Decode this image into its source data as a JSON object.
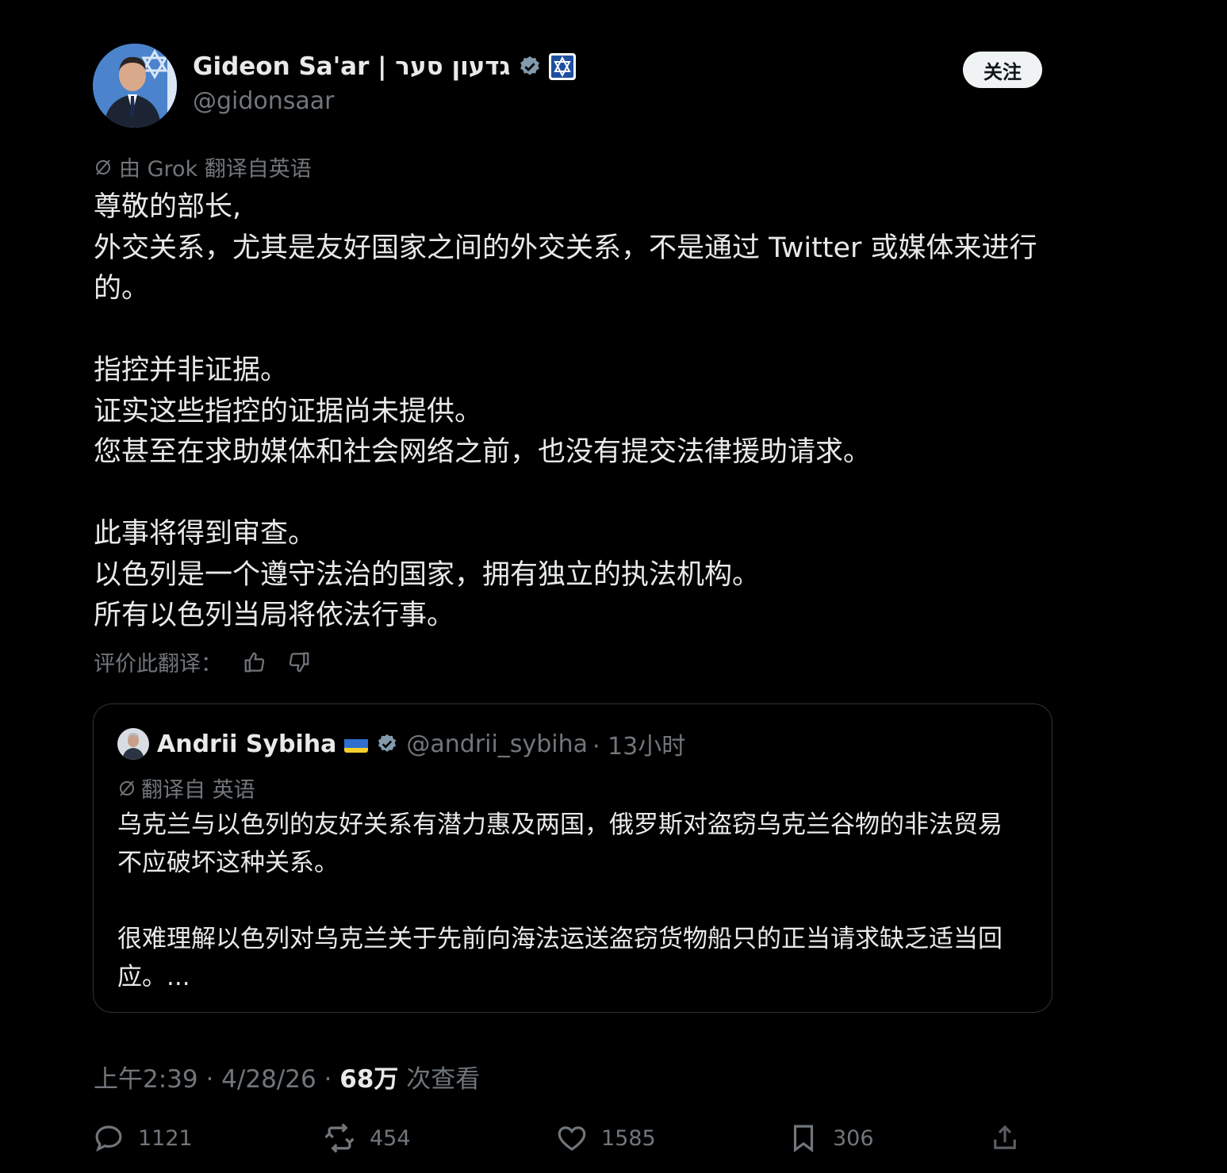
{
  "author": {
    "display_name": "Gideon Sa'ar | גדעון סער",
    "handle": "@gidonsaar",
    "follow_label": "关注"
  },
  "translation_note": "由 Grok 翻译自英语",
  "post": {
    "paragraphs": [
      [
        "尊敬的部长,",
        "外交关系，尤其是友好国家之间的外交关系，不是通过 Twitter 或媒体来进行的。"
      ],
      [
        "指控并非证据。",
        "证实这些指控的证据尚未提供。",
        "您甚至在求助媒体和社会网络之前，也没有提交法律援助请求。"
      ],
      [
        "此事将得到审查。",
        "以色列是一个遵守法治的国家，拥有独立的执法机构。",
        "所有以色列当局将依法行事。"
      ]
    ]
  },
  "rate_label": "评价此翻译：",
  "quote": {
    "name": "Andrii Sybiha",
    "handle": "@andrii_sybiha",
    "time": "· 13小时",
    "translated_label": "翻译自 英语",
    "paragraphs": [
      "乌克兰与以色列的友好关系有潜力惠及两国，俄罗斯对盗窃乌克兰谷物的非法贸易不应破坏这种关系。",
      "很难理解以色列对乌克兰关于先前向海法运送盗窃货物船只的正当请求缺乏适当回应。..."
    ]
  },
  "meta": {
    "time": "上午2:39 · 4/28/26 · ",
    "views": "68万",
    "views_label": " 次查看"
  },
  "actions": {
    "replies": "1121",
    "reposts": "454",
    "likes": "1585",
    "bookmarks": "306"
  },
  "colors": {
    "background": "#000000",
    "text": "#e7e9ea",
    "muted": "#71767b",
    "verified": "#829aab",
    "border": "#2f3336"
  }
}
